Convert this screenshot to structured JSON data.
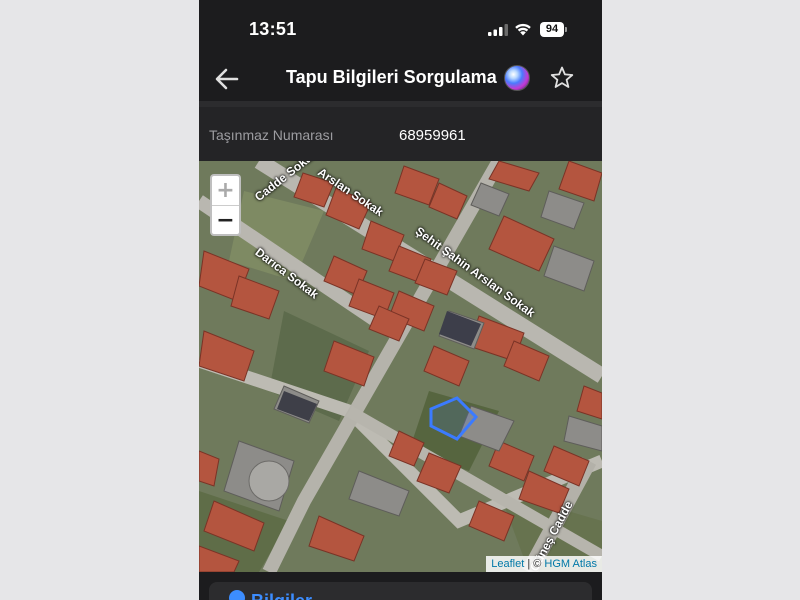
{
  "status_bar": {
    "time": "13:51",
    "battery": "94",
    "icons": [
      "signal-icon",
      "wifi-icon",
      "battery-icon"
    ]
  },
  "nav": {
    "title": "Tapu Bilgileri Sorgulama",
    "icons": [
      "back-arrow-icon",
      "siri-icon",
      "star-icon"
    ]
  },
  "field": {
    "label": "Taşınmaz Numarası",
    "value": "68959961"
  },
  "map": {
    "zoom_in": "+",
    "zoom_out": "−",
    "streets": [
      "Şehit Şahin Arslan Sokak",
      "Darıca Sokak",
      "Cadde Sokak",
      "Arslan Sokak",
      "Güneş Cadde"
    ],
    "attribution": {
      "leaflet": "Leaflet",
      "separator": " | © ",
      "provider": "HGM Atlas"
    },
    "parcel_color": "#3b7bff"
  },
  "info": {
    "title": "Bilgiler"
  }
}
